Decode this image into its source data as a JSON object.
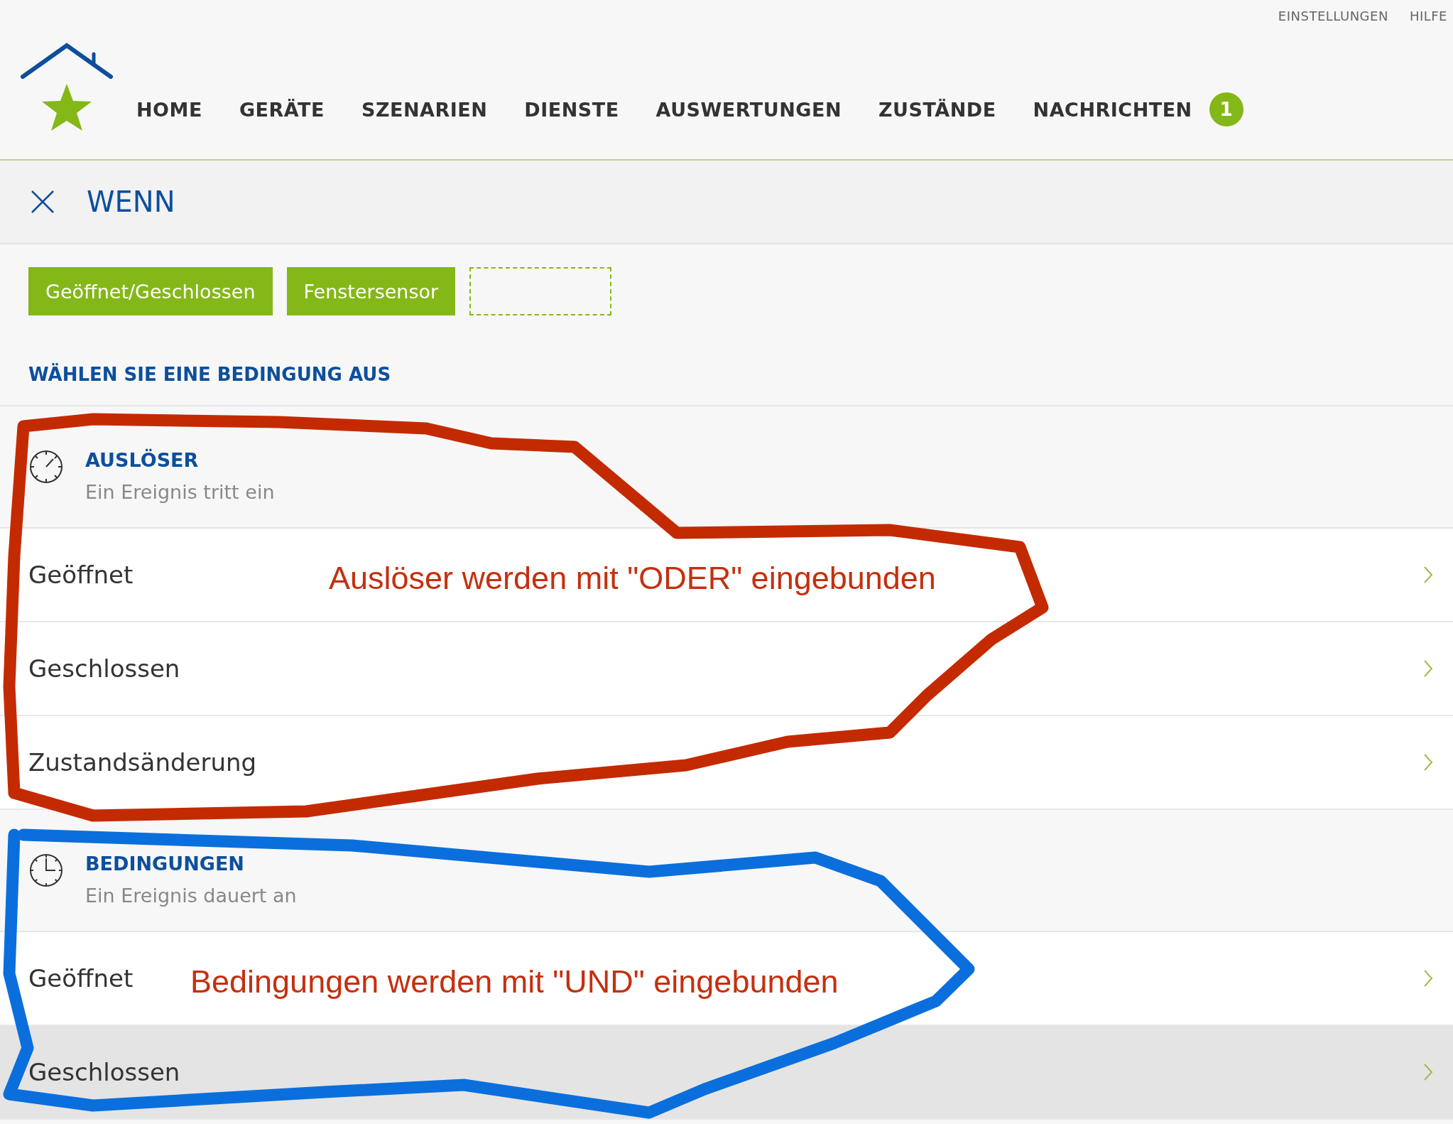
{
  "top_links": [
    "EINSTELLUNGEN",
    "HILFE"
  ],
  "nav": {
    "items": [
      {
        "label": "HOME"
      },
      {
        "label": "GERÄTE"
      },
      {
        "label": "SZENARIEN"
      },
      {
        "label": "DIENSTE"
      },
      {
        "label": "AUSWERTUNGEN"
      },
      {
        "label": "ZUSTÄNDE"
      },
      {
        "label": "NACHRICHTEN",
        "badge": "1"
      }
    ]
  },
  "panel": {
    "title": "WENN"
  },
  "chips": [
    {
      "label": "Geöffnet/Geschlossen",
      "kind": "filled"
    },
    {
      "label": "Fenstersensor",
      "kind": "filled"
    },
    {
      "kind": "empty"
    }
  ],
  "heading": "WÄHLEN SIE EINE BEDINGUNG AUS",
  "sections": [
    {
      "kind": "trigger",
      "title": "AUSLÖSER",
      "subtitle": "Ein Ereignis tritt ein",
      "annotation": "Auslöser werden mit \"ODER\" eingebunden",
      "rows": [
        {
          "label": "Geöffnet",
          "highlighted": false
        },
        {
          "label": "Geschlossen",
          "highlighted": false
        },
        {
          "label": "Zustandsänderung",
          "highlighted": false
        }
      ]
    },
    {
      "kind": "condition",
      "title": "BEDINGUNGEN",
      "subtitle": "Ein Ereignis dauert an",
      "annotation": "Bedingungen werden mit \"UND\" eingebunden",
      "rows": [
        {
          "label": "Geöffnet",
          "highlighted": false
        },
        {
          "label": "Geschlossen",
          "highlighted": true
        }
      ]
    }
  ]
}
